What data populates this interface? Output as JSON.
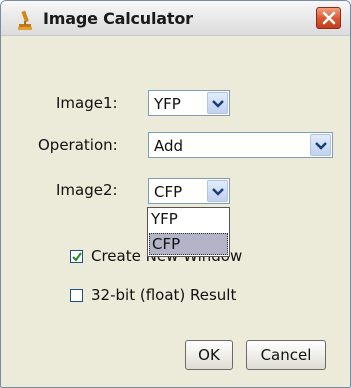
{
  "window": {
    "title": "Image Calculator",
    "icon": "microscope-icon",
    "close_icon": "close-icon"
  },
  "form": {
    "image1": {
      "label": "Image1:",
      "value": "YFP"
    },
    "operation": {
      "label": "Operation:",
      "value": "Add"
    },
    "image2": {
      "label": "Image2:",
      "value": "CFP"
    },
    "dropdown_options": [
      {
        "label": "YFP",
        "selected": false
      },
      {
        "label": "CFP",
        "selected": true
      }
    ],
    "create_new_window": {
      "label": "Create New Window",
      "checked": true
    },
    "float_result": {
      "label": "32-bit (float) Result",
      "checked": false
    }
  },
  "buttons": {
    "ok": "OK",
    "cancel": "Cancel"
  },
  "colors": {
    "dialog_bg": "#ecead8",
    "close_button": "#dc5a32",
    "combo_border": "#7f9db9",
    "dropdown_selection": "#b4b4c8"
  }
}
